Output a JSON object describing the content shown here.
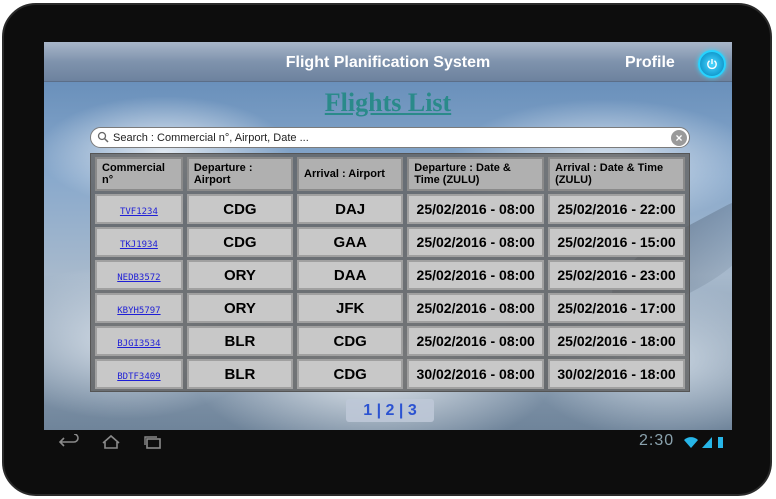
{
  "header": {
    "app_title": "Flight Planification System",
    "profile_label": "Profile"
  },
  "page": {
    "title": "Flights List"
  },
  "search": {
    "placeholder": "Search : Commercial n°, Airport, Date ..."
  },
  "table": {
    "headers": [
      "Commercial n°",
      "Departure : Airport",
      "Arrival : Airport",
      "Departure : Date & Time (ZULU)",
      "Arrival : Date & Time (ZULU)"
    ],
    "rows": [
      {
        "commercial": "TVF1234",
        "dep_airport": "CDG",
        "arr_airport": "DAJ",
        "dep_time": "25/02/2016 - 08:00",
        "arr_time": "25/02/2016 - 22:00"
      },
      {
        "commercial": "TKJ1934",
        "dep_airport": "CDG",
        "arr_airport": "GAA",
        "dep_time": "25/02/2016 - 08:00",
        "arr_time": "25/02/2016 - 15:00"
      },
      {
        "commercial": "NEDB3572",
        "dep_airport": "ORY",
        "arr_airport": "DAA",
        "dep_time": "25/02/2016 - 08:00",
        "arr_time": "25/02/2016 - 23:00"
      },
      {
        "commercial": "KBYH5797",
        "dep_airport": "ORY",
        "arr_airport": "JFK",
        "dep_time": "25/02/2016 - 08:00",
        "arr_time": "25/02/2016 - 17:00"
      },
      {
        "commercial": "BJGI3534",
        "dep_airport": "BLR",
        "arr_airport": "CDG",
        "dep_time": "25/02/2016 - 08:00",
        "arr_time": "25/02/2016 - 18:00"
      },
      {
        "commercial": "BDTF3409",
        "dep_airport": "BLR",
        "arr_airport": "CDG",
        "dep_time": "30/02/2016 - 08:00",
        "arr_time": "30/02/2016 - 18:00"
      }
    ]
  },
  "pagination": {
    "pages": [
      "1",
      "2",
      "3"
    ],
    "separator": "|"
  },
  "system_bar": {
    "clock": "2:30",
    "icons": [
      "back-icon",
      "home-icon",
      "recent-apps-icon",
      "wifi-icon",
      "signal-icon",
      "battery-icon"
    ]
  },
  "colors": {
    "title_teal": "#2a8a8a",
    "link_blue": "#1f1fd6",
    "power_cyan": "#28d3ff",
    "page_link_blue": "#2c53d1"
  }
}
